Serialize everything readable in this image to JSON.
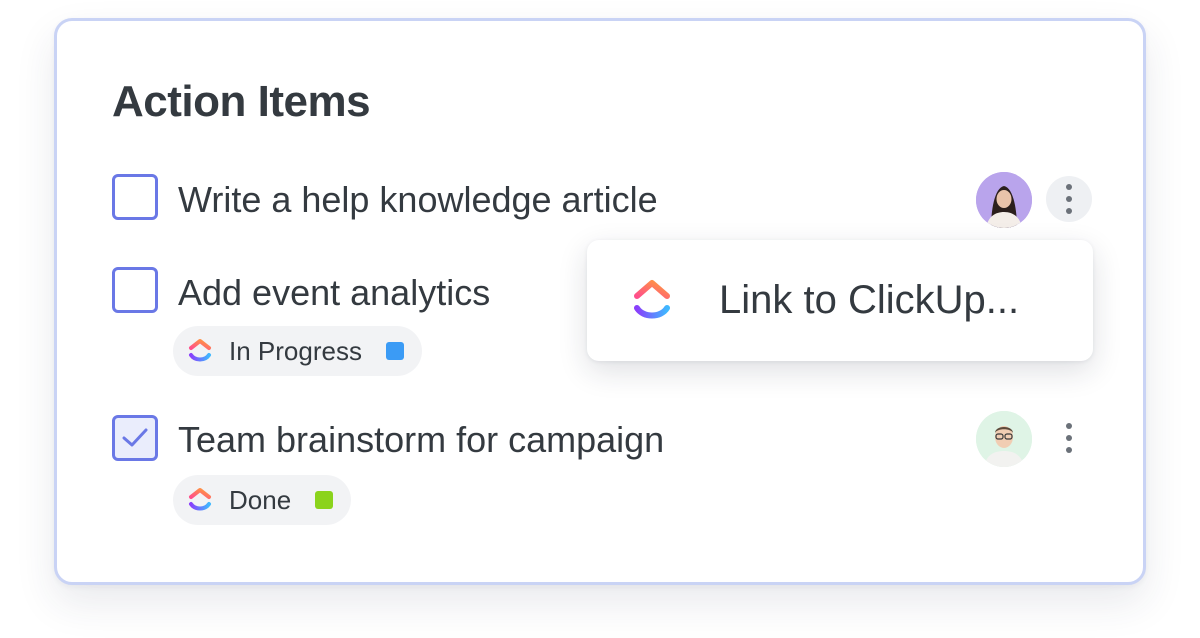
{
  "panel": {
    "title": "Action Items"
  },
  "tasks": [
    {
      "label": "Write a help knowledge article",
      "checked": false,
      "assignee": "avatar",
      "menu_icon": "more-vertical-icon",
      "menu_active": true
    },
    {
      "label": "Add event analytics",
      "checked": false,
      "status": {
        "text": "In Progress",
        "color": "#3b9bf5",
        "logo": "clickup-logo-icon"
      }
    },
    {
      "label": "Team brainstorm for campaign",
      "checked": true,
      "assignee": "avatar",
      "menu_icon": "more-vertical-icon",
      "status": {
        "text": "Done",
        "color": "#8bd31c",
        "logo": "clickup-logo-icon"
      }
    }
  ],
  "popup": {
    "item_label": "Link to ClickUp...",
    "icon": "clickup-logo-icon"
  },
  "colors": {
    "checkbox_border": "#6a78e6",
    "card_border": "#c9d3f5",
    "text": "#343a40"
  }
}
